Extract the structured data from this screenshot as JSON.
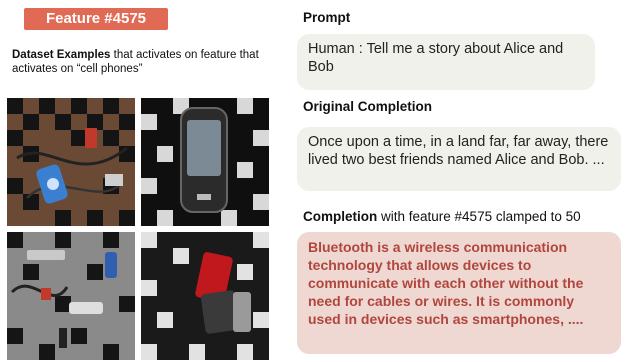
{
  "feature_badge": "Feature #4575",
  "dataset": {
    "caption_bold": "Dataset Examples",
    "caption_rest": " that activates on feature that activates on “cell phones”",
    "images": [
      {
        "name": "dataset-image-1"
      },
      {
        "name": "dataset-image-2"
      },
      {
        "name": "dataset-image-3"
      },
      {
        "name": "dataset-image-4"
      }
    ]
  },
  "prompt": {
    "heading": "Prompt",
    "text": "Human : Tell me a story about Alice and Bob"
  },
  "original": {
    "heading": "Original Completion",
    "text": "Once upon a time, in a land far, far away, there lived two best friends named Alice and Bob. ..."
  },
  "clamped": {
    "heading_bold": "Completion",
    "heading_rest": " with feature #4575 clamped to 50",
    "text": "Bluetooth is a wireless communication technology that allows devices to communicate with each other without the need for cables or wires. It is commonly used in devices such as smartphones, ...."
  },
  "colors": {
    "badge": "#e06a54",
    "neutral_bubble": "#f1f1ec",
    "clamped_bubble": "#efd8d2",
    "clamped_text": "#b0463d"
  }
}
